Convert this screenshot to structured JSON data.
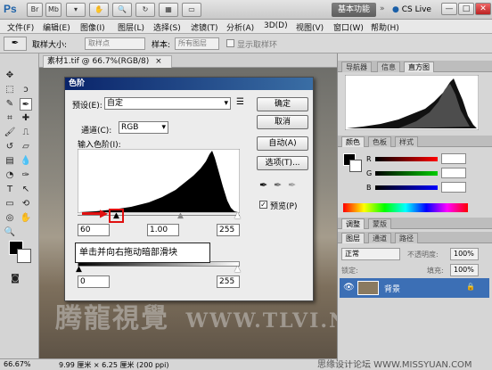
{
  "app": {
    "logo": "Ps",
    "workspace": "基本功能",
    "cs_live": "CS Live",
    "window_controls": [
      "—",
      "□",
      "✕"
    ]
  },
  "menu": [
    "文件(F)",
    "编辑(E)",
    "图像(I)",
    "图层(L)",
    "选择(S)",
    "滤镜(T)",
    "分析(A)",
    "3D(D)",
    "视图(V)",
    "窗口(W)",
    "帮助(H)"
  ],
  "options": {
    "sample_size_label": "取样大小:",
    "sample_size_value": "取样点",
    "sample_label": "样本:",
    "sample_value": "所有图层",
    "show_ring": "显示取样环"
  },
  "document": {
    "tab_title": "素材1.tif @ 66.7%(RGB/8)",
    "close": "×"
  },
  "status": {
    "zoom": "66.67%",
    "info": "9.99 厘米 × 6.25 厘米 (200 ppi)"
  },
  "watermark": {
    "chinese": "腾龍視覺",
    "url": "WWW.TLVI.NET"
  },
  "source_watermark": "思缘设计论坛  WWW.MISSYUAN.COM",
  "levels_dialog": {
    "title": "色阶",
    "preset_label": "预设(E):",
    "preset_value": "自定",
    "channel_label": "通道(C):",
    "channel_value": "RGB",
    "input_label": "输入色阶(I):",
    "input_black": "60",
    "input_gamma": "1.00",
    "input_white": "255",
    "output_black": "0",
    "output_white": "255",
    "ok": "确定",
    "cancel": "取消",
    "auto": "自动(A)",
    "options": "选项(T)...",
    "preview": "预览(P)",
    "callout": "单击并向右拖动暗部滑块"
  },
  "panels": {
    "tabs_top": [
      "导航器",
      "信息",
      "直方图"
    ],
    "tabs_color": [
      "颜色",
      "色板",
      "样式"
    ],
    "color_channels": [
      "R",
      "G",
      "B"
    ],
    "tabs_adjust": [
      "调整",
      "蒙版"
    ],
    "tabs_layers": [
      "图层",
      "通道",
      "路径"
    ],
    "blend_mode": "正常",
    "opacity_label": "不透明度:",
    "opacity_value": "100%",
    "lock_label": "锁定:",
    "fill_label": "填充:",
    "fill_value": "100%",
    "layer_name": "背景"
  }
}
